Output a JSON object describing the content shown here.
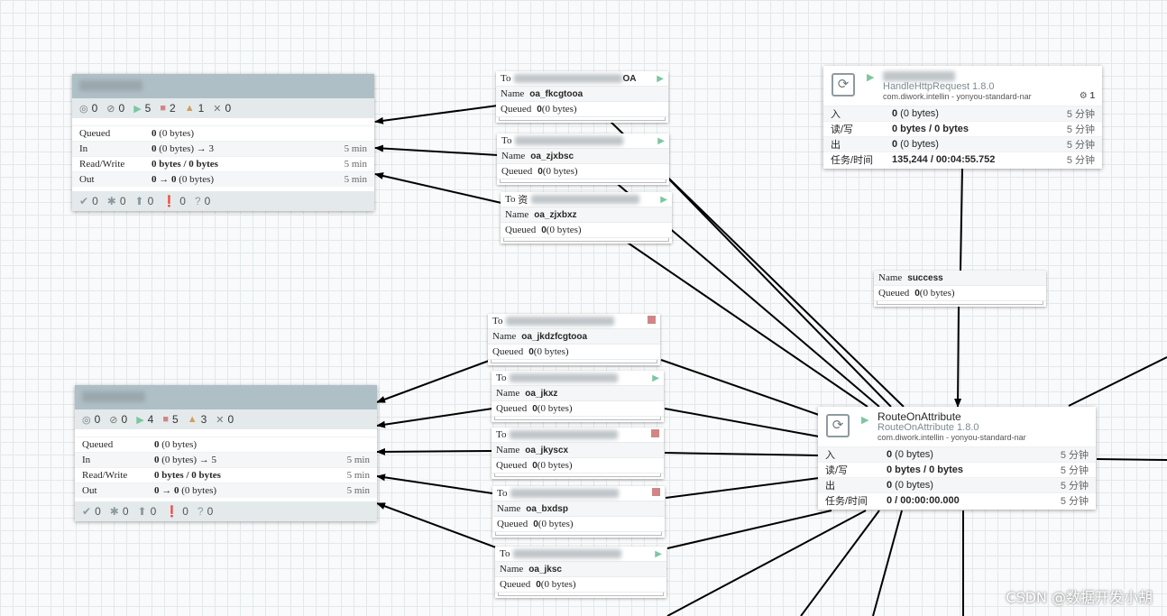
{
  "pg1": {
    "stats": {
      "transmitting": "0",
      "not_transmitting": "0",
      "running": "5",
      "stopped": "2",
      "invalid": "1",
      "disabled": "0"
    },
    "rows": [
      {
        "label": "Queued",
        "value": "0",
        "extra": " (0 bytes)",
        "time": ""
      },
      {
        "label": "In",
        "value": "0",
        "extra": " (0 bytes) → 3",
        "time": "5 min"
      },
      {
        "label": "Read/Write",
        "value": "0 bytes / 0 bytes",
        "extra": "",
        "time": "5 min"
      },
      {
        "label": "Out",
        "value": "0 → 0",
        "extra": " (0 bytes)",
        "time": "5 min"
      }
    ],
    "footer": {
      "up_to_date": "0",
      "locally_modified": "0",
      "stale": "0",
      "errors": "0",
      "unknown": "0"
    }
  },
  "pg2": {
    "stats": {
      "transmitting": "0",
      "not_transmitting": "0",
      "running": "4",
      "stopped": "5",
      "invalid": "3",
      "disabled": "0"
    },
    "rows": [
      {
        "label": "Queued",
        "value": "0",
        "extra": " (0 bytes)",
        "time": ""
      },
      {
        "label": "In",
        "value": "0",
        "extra": " (0 bytes) → 5",
        "time": "5 min"
      },
      {
        "label": "Read/Write",
        "value": "0 bytes / 0 bytes",
        "extra": "",
        "time": "5 min"
      },
      {
        "label": "Out",
        "value": "0 → 0",
        "extra": " (0 bytes)",
        "time": "5 min"
      }
    ],
    "footer": {
      "up_to_date": "0",
      "locally_modified": "0",
      "stale": "0",
      "errors": "0",
      "unknown": "0"
    }
  },
  "labels": {
    "to": "To",
    "name": "Name",
    "queued": "Queued"
  },
  "connections": [
    {
      "to_visible": "OA",
      "name": "oa_fkcgtooa",
      "queued": "0",
      "queued_bytes": " (0 bytes)",
      "status": "running"
    },
    {
      "to_visible": "",
      "name": "oa_zjxbsc",
      "queued": "0",
      "queued_bytes": " (0 bytes)",
      "status": "running"
    },
    {
      "to_visible": "资",
      "name": "oa_zjxbxz",
      "queued": "0",
      "queued_bytes": " (0 bytes)",
      "status": "running"
    },
    {
      "to_visible": "",
      "name": "oa_jkdzfcgtooa",
      "queued": "0",
      "queued_bytes": " (0 bytes)",
      "status": "stopped"
    },
    {
      "to_visible": "",
      "name": "oa_jkxz",
      "queued": "0",
      "queued_bytes": " (0 bytes)",
      "status": "running"
    },
    {
      "to_visible": "",
      "name": "oa_jkyscx",
      "queued": "0",
      "queued_bytes": " (0 bytes)",
      "status": "stopped"
    },
    {
      "to_visible": "",
      "name": "oa_bxdsp",
      "queued": "0",
      "queued_bytes": " (0 bytes)",
      "status": "stopped"
    },
    {
      "to_visible": "",
      "name": "oa_jksc",
      "queued": "0",
      "queued_bytes": " (0 bytes)",
      "status": "running"
    }
  ],
  "success_conn": {
    "name": "success",
    "queued": "0",
    "queued_bytes": " (0 bytes)"
  },
  "processor1": {
    "type": "HandleHttpRequest 1.8.0",
    "bundle": "com.diwork.intellin - yonyou-standard-nar",
    "tasks": "1",
    "rows": [
      {
        "label": "入",
        "value": "0",
        "extra": " (0 bytes)",
        "time": "5 分钟"
      },
      {
        "label": "读/写",
        "value": "0 bytes / 0 bytes",
        "extra": "",
        "time": "5 分钟"
      },
      {
        "label": "出",
        "value": "0",
        "extra": " (0 bytes)",
        "time": "5 分钟"
      },
      {
        "label": "任务/时间",
        "value": "135,244 / 00:04:55.752",
        "extra": "",
        "time": "5 分钟"
      }
    ]
  },
  "processor2": {
    "name": "RouteOnAttribute",
    "type": "RouteOnAttribute 1.8.0",
    "bundle": "com.diwork.intellin - yonyou-standard-nar",
    "rows": [
      {
        "label": "入",
        "value": "0",
        "extra": " (0 bytes)",
        "time": "5 分钟"
      },
      {
        "label": "读/写",
        "value": "0 bytes / 0 bytes",
        "extra": "",
        "time": "5 分钟"
      },
      {
        "label": "出",
        "value": "0",
        "extra": " (0 bytes)",
        "time": "5 分钟"
      },
      {
        "label": "任务/时间",
        "value": "0 / 00:00:00.000",
        "extra": "",
        "time": "5 分钟"
      }
    ]
  },
  "watermark": "CSDN @数据开发小胡",
  "colors": {
    "header": "#afbfc6",
    "stats_bg": "#e4eaec",
    "running": "#7dc7a0",
    "stopped": "#d18686",
    "invalid": "#cf9f5d",
    "canvas": "#f9fafb",
    "grid": "#e3e8eb"
  }
}
